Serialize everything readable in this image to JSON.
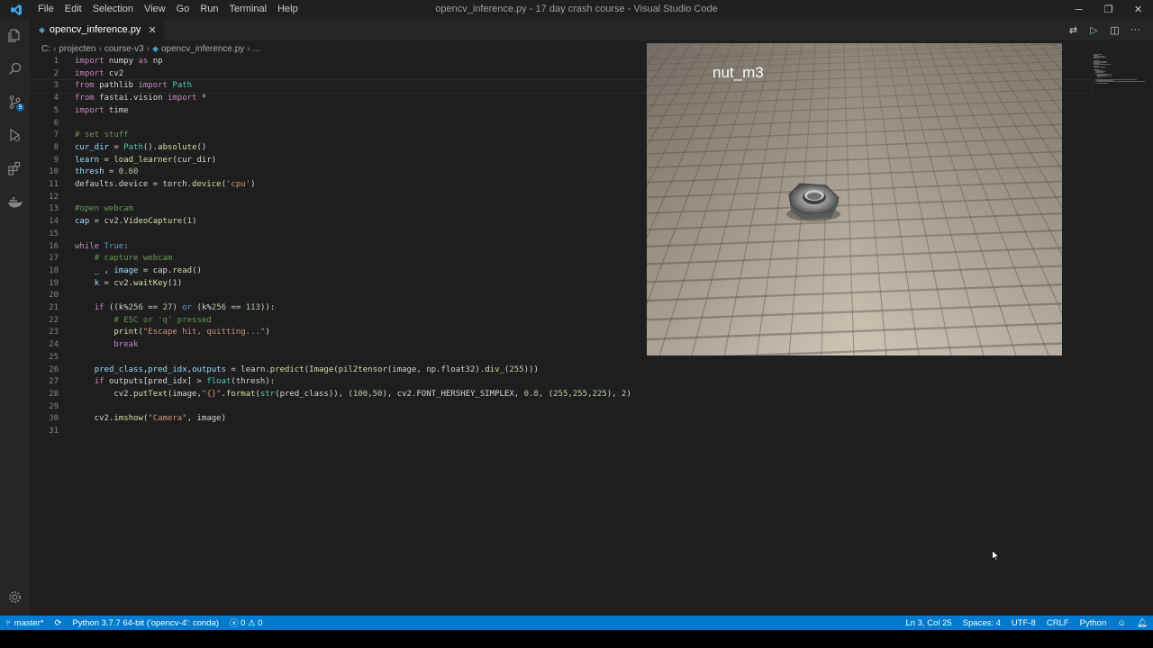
{
  "window": {
    "title": "opencv_inference.py - 17 day crash course - Visual Studio Code",
    "menu": [
      "File",
      "Edit",
      "Selection",
      "View",
      "Go",
      "Run",
      "Terminal",
      "Help"
    ],
    "controls": {
      "minimize": "─",
      "restore": "❐",
      "close": "✕"
    }
  },
  "activity_bar": {
    "items": [
      "explorer-icon",
      "search-icon",
      "source-control-icon",
      "run-debug-icon",
      "extensions-icon",
      "docker-icon"
    ],
    "source_control_badge": "9",
    "manage": "gear-icon"
  },
  "tab": {
    "label": "opencv_inference.py",
    "close": "✕"
  },
  "breadcrumb": [
    "C:",
    "projecten",
    "course-v3",
    "opencv_inference.py",
    "..."
  ],
  "editor": {
    "lines": [
      {
        "n": "1",
        "html": "<span class='kw'>import</span> numpy <span class='kw'>as</span> np"
      },
      {
        "n": "2",
        "html": "<span class='kw'>import</span> cv2"
      },
      {
        "n": "3",
        "html": "<span class='kw'>from</span> pathlib <span class='kw'>import</span> <span class='tp'>Path</span>"
      },
      {
        "n": "4",
        "html": "<span class='kw'>from</span> fastai.vision <span class='kw'>import</span> *"
      },
      {
        "n": "5",
        "html": "<span class='kw'>import</span> time"
      },
      {
        "n": "6",
        "html": ""
      },
      {
        "n": "7",
        "html": "<span class='cm'># set stuff</span>"
      },
      {
        "n": "8",
        "html": "<span class='vr'>cur_dir</span> = <span class='tp'>Path</span>().<span class='fn'>absolute</span>()"
      },
      {
        "n": "9",
        "html": "<span class='vr'>learn</span> = <span class='fn'>load_learner</span>(cur_dir)"
      },
      {
        "n": "10",
        "html": "<span class='vr'>thresh</span> = <span class='nm'>0.60</span>"
      },
      {
        "n": "11",
        "html": "defaults.device = torch.<span class='fn'>device</span>(<span class='st'>'cpu'</span>)"
      },
      {
        "n": "12",
        "html": ""
      },
      {
        "n": "13",
        "html": "<span class='cm'>#open webcam</span>"
      },
      {
        "n": "14",
        "html": "<span class='vr'>cap</span> = cv2.<span class='fn'>VideoCapture</span>(<span class='nm'>1</span>)"
      },
      {
        "n": "15",
        "html": ""
      },
      {
        "n": "16",
        "html": "<span class='kw'>while</span> <span class='kb'>True</span>:"
      },
      {
        "n": "17",
        "html": "    <span class='cm'># capture webcam</span>"
      },
      {
        "n": "18",
        "html": "    _ , <span class='vr'>image</span> = cap.<span class='fn'>read</span>()"
      },
      {
        "n": "19",
        "html": "    <span class='vr'>k</span> = cv2.<span class='fn'>waitKey</span>(<span class='nm'>1</span>)"
      },
      {
        "n": "20",
        "html": ""
      },
      {
        "n": "21",
        "html": "    <span class='kw'>if</span> ((k%<span class='nm'>256</span> == <span class='nm'>27</span>) <span class='kb'>or</span> (k%<span class='nm'>256</span> == <span class='nm'>113</span>)):"
      },
      {
        "n": "22",
        "html": "        <span class='cm'># ESC or 'q' pressed</span>"
      },
      {
        "n": "23",
        "html": "        <span class='fn'>print</span>(<span class='st'>\"Escape hit, quitting...\"</span>)"
      },
      {
        "n": "24",
        "html": "        <span class='kw'>break</span>"
      },
      {
        "n": "25",
        "html": ""
      },
      {
        "n": "26",
        "html": "    <span class='vr'>pred_class</span>,<span class='vr'>pred_idx</span>,<span class='vr'>outputs</span> = learn.<span class='fn'>predict</span>(<span class='fn'>Image</span>(<span class='fn'>pil2tensor</span>(image, np.float32).<span class='fn'>div_</span>(<span class='nm'>255</span>)))"
      },
      {
        "n": "27",
        "html": "    <span class='kw'>if</span> outputs[pred_idx] &gt; <span class='tp'>float</span>(thresh):"
      },
      {
        "n": "28",
        "html": "        cv2.<span class='fn'>putText</span>(image,<span class='st'>\"{}\"</span>.<span class='fn'>format</span>(<span class='tp'>str</span>(pred_class)), (<span class='nm'>100</span>,<span class='nm'>50</span>), cv2.FONT_HERSHEY_SIMPLEX, <span class='nm'>0.8</span>, (<span class='nm'>255</span>,<span class='nm'>255</span>,<span class='nm'>225</span>), <span class='nm'>2</span>)"
      },
      {
        "n": "29",
        "html": ""
      },
      {
        "n": "30",
        "html": "    cv2.<span class='fn'>imshow</span>(<span class='st'>\"Camera\"</span>, image)"
      },
      {
        "n": "31",
        "html": ""
      }
    ]
  },
  "camera_window": {
    "overlay_text": "nut_m3"
  },
  "statusbar": {
    "branch": "master*",
    "interpreter": "Python 3.7.7 64-bit ('opencv-4': conda)",
    "errors": "0",
    "warnings": "0",
    "cursor": "Ln 3, Col 25",
    "spaces": "Spaces: 4",
    "encoding": "UTF-8",
    "eol": "CRLF",
    "language": "Python"
  },
  "colors": {
    "accent": "#007acc",
    "editor_bg": "#1e1e1e",
    "sidebar_bg": "#252526"
  }
}
